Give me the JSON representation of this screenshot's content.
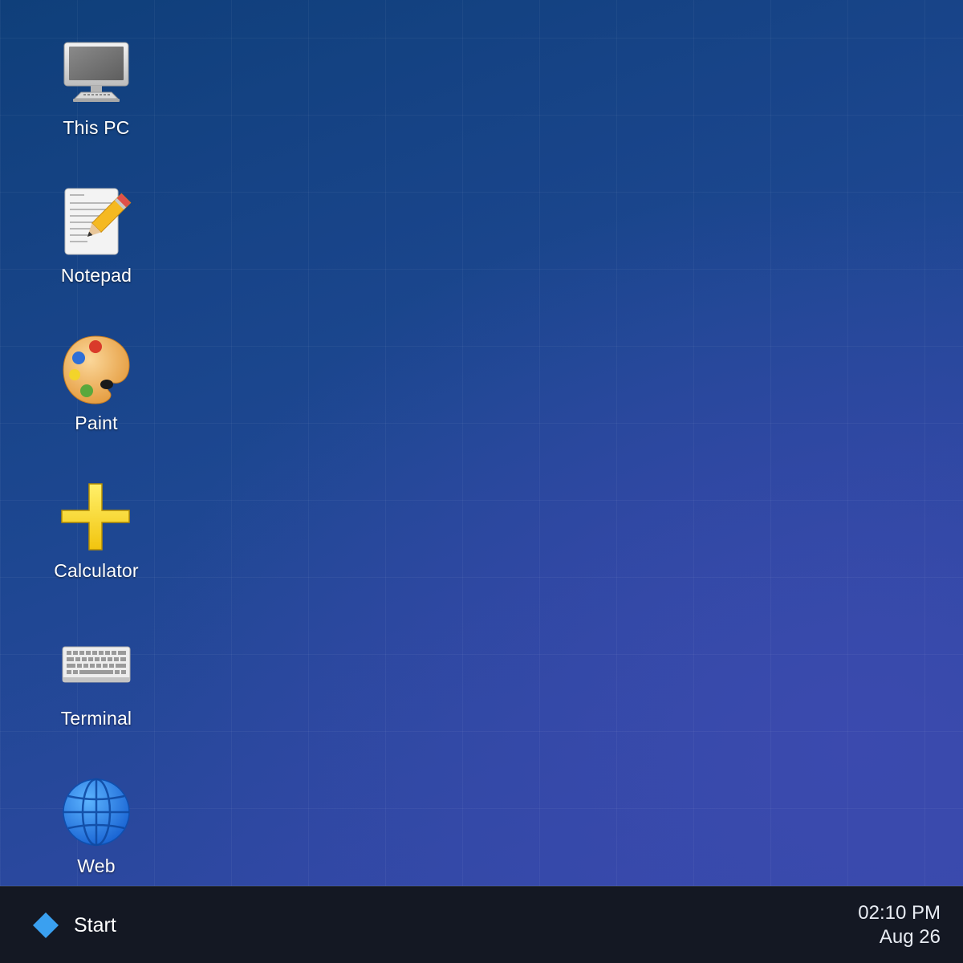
{
  "desktop": {
    "icons": [
      {
        "label": "This PC",
        "icon": "computer-icon"
      },
      {
        "label": "Notepad",
        "icon": "notepad-icon"
      },
      {
        "label": "Paint",
        "icon": "paint-palette-icon"
      },
      {
        "label": "Calculator",
        "icon": "calculator-plus-icon"
      },
      {
        "label": "Terminal",
        "icon": "keyboard-icon"
      },
      {
        "label": "Web",
        "icon": "globe-icon"
      }
    ]
  },
  "taskbar": {
    "start_label": "Start",
    "start_icon": "diamond-logo-icon",
    "clock": {
      "time": "02:10 PM",
      "date": "Aug 26"
    }
  },
  "colors": {
    "accent": "#3aa0f0",
    "taskbar": "#141823",
    "desktop_top": "#0f3f7a",
    "desktop_bottom": "#3648ab"
  }
}
